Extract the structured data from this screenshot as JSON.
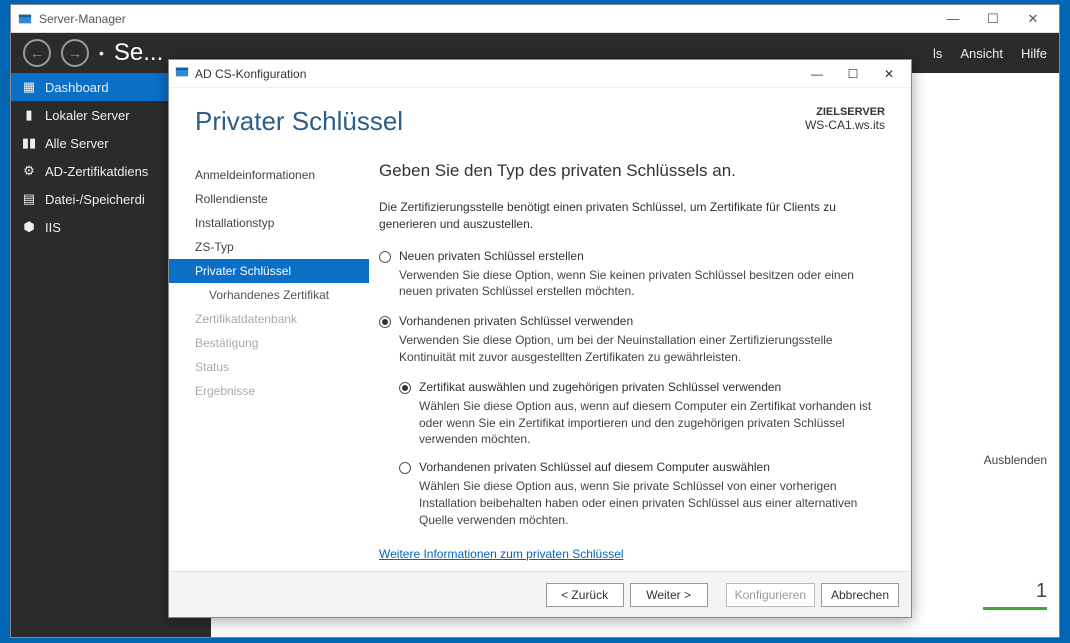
{
  "serverManager": {
    "title": "Server-Manager",
    "breadcrumbTruncated": "Se...",
    "menu": {
      "ansicht": "Ansicht",
      "hilfe": "Hilfe",
      "lsSuffix": "ls"
    },
    "sidebar": [
      {
        "label": "Dashboard",
        "icon": "dashboard"
      },
      {
        "label": "Lokaler Server",
        "icon": "server"
      },
      {
        "label": "Alle Server",
        "icon": "servers"
      },
      {
        "label": "AD-Zertifikatdiens",
        "icon": "cert"
      },
      {
        "label": "Datei-/Speicherdi",
        "icon": "storage"
      },
      {
        "label": "IIS",
        "icon": "iis"
      }
    ],
    "ausblenden": "Ausblenden",
    "count": "1"
  },
  "dialog": {
    "title": "AD CS-Konfiguration",
    "heading": "Privater Schlüssel",
    "serverLabel": "ZIELSERVER",
    "serverName": "WS-CA1.ws.its",
    "steps": [
      {
        "label": "Anmeldeinformationen",
        "state": "done"
      },
      {
        "label": "Rollendienste",
        "state": "done"
      },
      {
        "label": "Installationstyp",
        "state": "done"
      },
      {
        "label": "ZS-Typ",
        "state": "done"
      },
      {
        "label": "Privater Schlüssel",
        "state": "active"
      },
      {
        "label": "Vorhandenes Zertifikat",
        "state": "sub"
      },
      {
        "label": "Zertifikatdatenbank",
        "state": "disabled"
      },
      {
        "label": "Bestätigung",
        "state": "disabled"
      },
      {
        "label": "Status",
        "state": "disabled"
      },
      {
        "label": "Ergebnisse",
        "state": "disabled"
      }
    ],
    "formTitle": "Geben Sie den Typ des privaten Schlüssels an.",
    "formIntro": "Die Zertifizierungsstelle benötigt einen privaten Schlüssel, um Zertifikate für Clients zu generieren und auszustellen.",
    "opt1": {
      "label": "Neuen privaten Schlüssel erstellen",
      "desc": "Verwenden Sie diese Option, wenn Sie keinen privaten Schlüssel besitzen oder einen neuen privaten Schlüssel erstellen möchten."
    },
    "opt2": {
      "label": "Vorhandenen privaten Schlüssel verwenden",
      "desc": "Verwenden Sie diese Option, um bei der Neuinstallation einer Zertifizierungsstelle Kontinuität mit zuvor ausgestellten Zertifikaten zu gewährleisten.",
      "subA": {
        "label": "Zertifikat auswählen und zugehörigen privaten Schlüssel verwenden",
        "desc": "Wählen Sie diese Option aus, wenn auf diesem Computer ein Zertifikat vorhanden ist oder wenn Sie ein Zertifikat importieren und den zugehörigen privaten Schlüssel verwenden möchten."
      },
      "subB": {
        "label": "Vorhandenen privaten Schlüssel auf diesem Computer auswählen",
        "desc": "Wählen Sie diese Option aus, wenn Sie private Schlüssel von einer vorherigen Installation beibehalten haben oder einen privaten Schlüssel aus einer alternativen Quelle verwenden möchten."
      }
    },
    "moreInfoLink": "Weitere Informationen zum privaten Schlüssel",
    "buttons": {
      "back": "< Zurück",
      "next": "Weiter >",
      "configure": "Konfigurieren",
      "cancel": "Abbrechen"
    }
  }
}
